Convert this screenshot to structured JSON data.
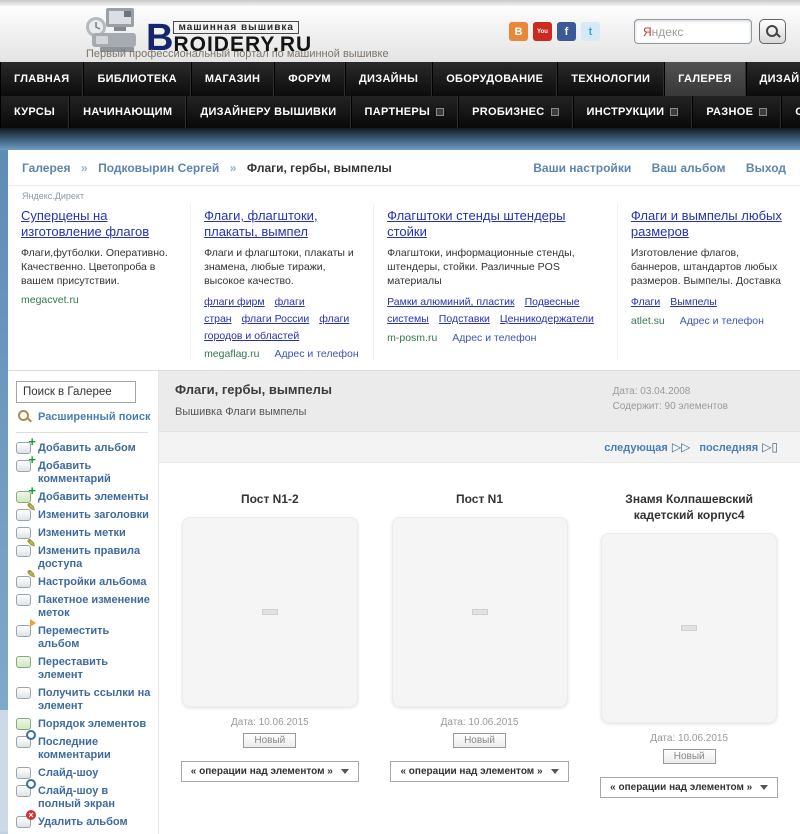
{
  "colors": {
    "nav_bg": "#111111",
    "accent_link_blue": "#5c85ad",
    "ad_link_blue": "#2633b0",
    "ad_domain_green": "#33774f",
    "sidebar_link_blue": "#3e6b9e",
    "body_blue": "#6f9dc2",
    "album_head_grey": "#ebebeb"
  },
  "header": {
    "logo": {
      "brand_prefix": "B",
      "brand_top": "машинная вышивка",
      "brand_rest": "ROIDERY.RU",
      "tagline": "Первый профессиональный портал по машинной вышивке"
    },
    "social": [
      {
        "name": "blogger",
        "label": "B"
      },
      {
        "name": "youtube",
        "label": "You"
      },
      {
        "name": "facebook",
        "label": "f"
      },
      {
        "name": "twitter",
        "label": "t"
      }
    ],
    "search": {
      "first": "Я",
      "rest": "ндекс"
    }
  },
  "nav": {
    "row1": [
      {
        "label": "ГЛАВНАЯ"
      },
      {
        "label": "БИБЛИОТЕКА"
      },
      {
        "label": "МАГАЗИН"
      },
      {
        "label": "ФОРУМ"
      },
      {
        "label": "ДИЗАЙНЫ"
      },
      {
        "label": "ОБОРУДОВАНИЕ"
      },
      {
        "label": "ТЕХНОЛОГИИ"
      },
      {
        "label": "ГАЛЕРЕЯ",
        "active": true
      },
      {
        "label": "ДИЗАЙНЕРЫ"
      }
    ],
    "row2": [
      {
        "label": "КУРСЫ"
      },
      {
        "label": "НАЧИНАЮЩИМ"
      },
      {
        "label": "ДИЗАЙНЕРУ ВЫШИВКИ"
      },
      {
        "label": "ПАРТНЕРЫ",
        "has_dropdown": true
      },
      {
        "label": "PROБИЗНЕС",
        "has_dropdown": true
      },
      {
        "label": "ИНСТРУКЦИИ",
        "has_dropdown": true
      },
      {
        "label": "РАЗНОЕ",
        "has_dropdown": true
      },
      {
        "label": "О НАС",
        "has_dropdown": true
      }
    ]
  },
  "breadcrumb": {
    "separator": "»",
    "items": [
      "Галерея",
      "Подковырин Сергей"
    ],
    "current": "Флаги, гербы, вымпелы",
    "user_links": [
      "Ваши настройки",
      "Ваш альбом",
      "Выход"
    ]
  },
  "ads_label": "Яндекс.Директ",
  "ads": [
    {
      "title": "Суперцены на изготовление флагов",
      "body": "Флаги,футболки. Оперативно. Качественно. Цветопроба в вашем присутствии.",
      "links": [],
      "domain": "megacvet.ru",
      "extra": ""
    },
    {
      "title": "Флаги, флагштоки, плакаты, вымпел",
      "body": "Флаги и флагштоки, плакаты и знамена, любые тиражи, высокое качество.",
      "links": [
        "флаги фирм",
        "флаги стран",
        "флаги России",
        "флаги городов и областей"
      ],
      "domain": "megaflag.ru",
      "extra": "Адрес и телефон"
    },
    {
      "title": "Флагштоки стенды штендеры стойки",
      "body": "Флагштоки, информационные стенды, штендеры, стойки. Различные POS материалы",
      "links": [
        "Рамки алюминий, пластик",
        "Подвесные системы",
        "Подставки",
        "Ценникодержатели"
      ],
      "domain": "m-posm.ru",
      "extra": "Адрес и телефон"
    },
    {
      "title": "Флаги и вымпелы любых размеров",
      "body": "Изготовление флагов, баннеров, штандартов любых размеров. Вымпелы. Доставка",
      "links": [
        "Флаги",
        "Вымпелы"
      ],
      "domain": "atlet.su",
      "extra": "Адрес и телефон"
    }
  ],
  "sidebar": {
    "search_value": "Поиск в Галерее",
    "advanced_label": "Расширенный поиск",
    "items": [
      {
        "label": "Добавить альбом"
      },
      {
        "label": "Добавить комментарий"
      },
      {
        "label": "Добавить элементы"
      },
      {
        "label": "Изменить заголовки"
      },
      {
        "label": "Изменить метки"
      },
      {
        "label": "Изменить правила доступа"
      },
      {
        "label": "Настройки альбома"
      },
      {
        "label": "Пакетное изменение меток"
      },
      {
        "label": "Переместить альбом"
      },
      {
        "label": "Переставить элемент"
      },
      {
        "label": "Получить ссылки на элемент"
      },
      {
        "label": "Порядок элементов"
      },
      {
        "label": "Последние комментарии"
      },
      {
        "label": "Слайд-шоу"
      },
      {
        "label": "Слайд-шоу в полный экран"
      },
      {
        "label": "Удалить альбом"
      }
    ]
  },
  "album": {
    "title": "Флаги, гербы, вымпелы",
    "subtitle": "Вышивка Флаги вымпелы",
    "date": "Дата: 03.04.2008",
    "count": "Содержит: 90 элементов"
  },
  "pagination": {
    "next": "следующая",
    "next_icon": "▷▷",
    "last": "последняя",
    "last_icon": "▷▯"
  },
  "gallery": {
    "items": [
      {
        "title": "Пост N1-2",
        "date": "Дата: 10.06.2015",
        "badge": "Новый",
        "operations": "« операции над элементом »"
      },
      {
        "title": "Пост N1",
        "date": "Дата: 10.06.2015",
        "badge": "Новый",
        "operations": "« операции над элементом »"
      },
      {
        "title": "Знамя Колпашевский кадетский корпус4",
        "date": "Дата: 10.06.2015",
        "badge": "Новый",
        "operations": "« операции над элементом »"
      }
    ]
  }
}
